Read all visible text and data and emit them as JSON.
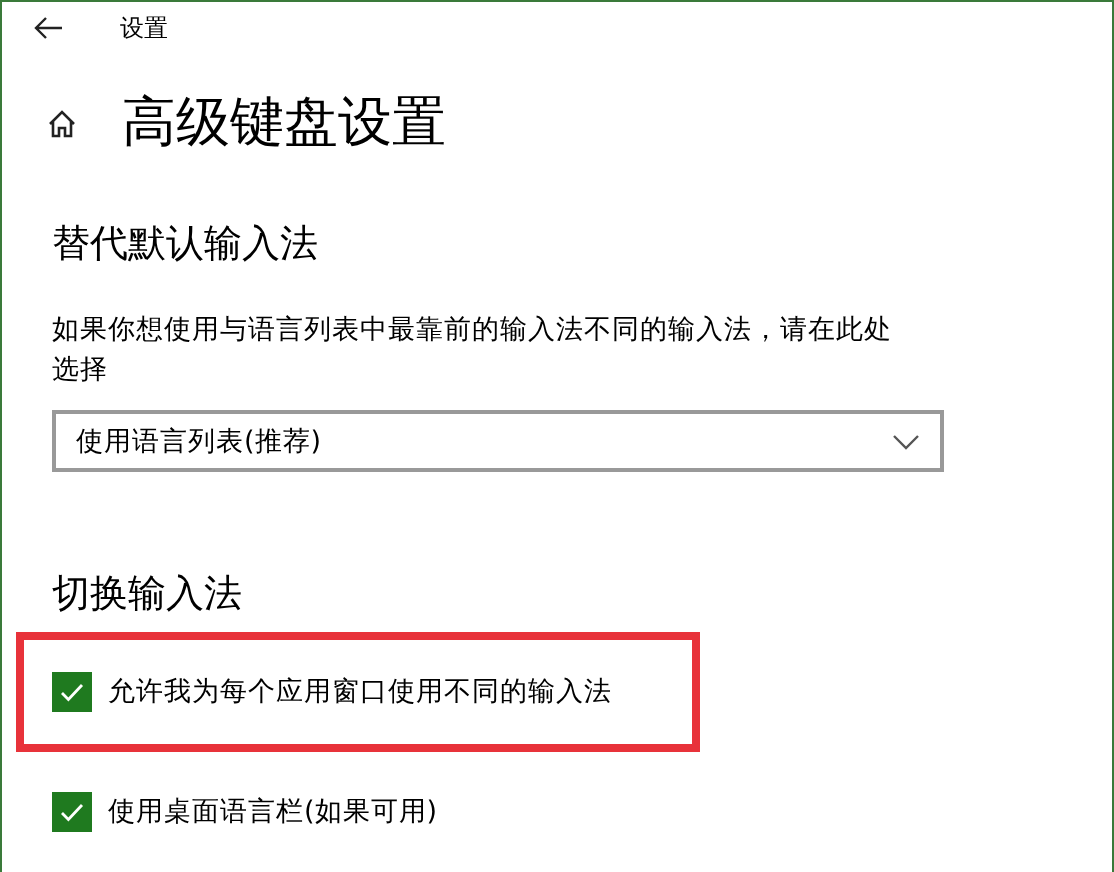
{
  "window": {
    "title": "设置"
  },
  "page": {
    "title": "高级键盘设置"
  },
  "override_section": {
    "heading": "替代默认输入法",
    "description": "如果你想使用与语言列表中最靠前的输入法不同的输入法，请在此处选择",
    "dropdown": {
      "value": "使用语言列表(推荐)"
    }
  },
  "switch_section": {
    "heading": "切换输入法",
    "options": [
      {
        "label": "允许我为每个应用窗口使用不同的输入法",
        "checked": true,
        "highlighted": true
      },
      {
        "label": "使用桌面语言栏(如果可用)",
        "checked": true,
        "highlighted": false
      }
    ]
  }
}
